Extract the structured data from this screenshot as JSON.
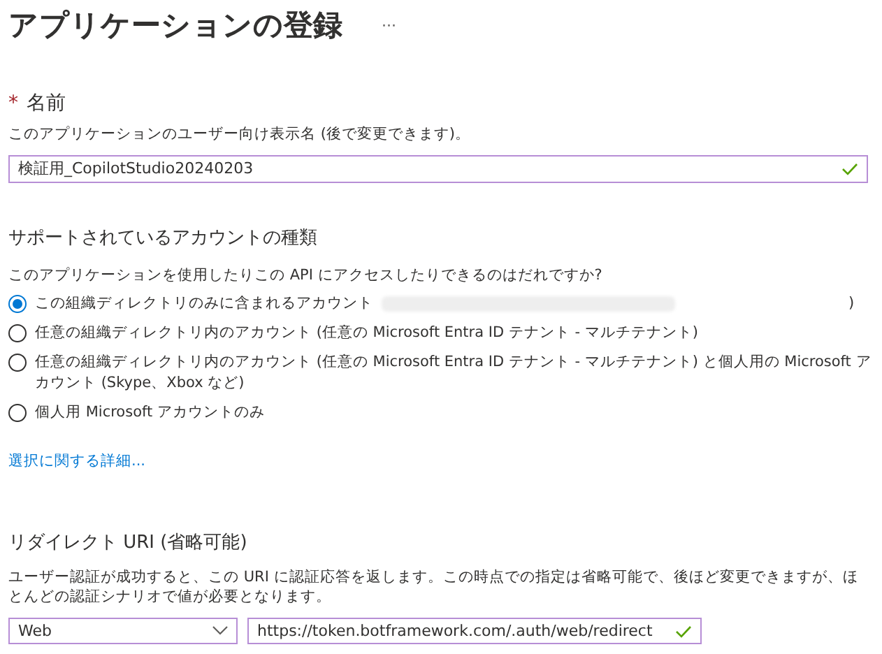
{
  "title": "アプリケーションの登録",
  "more": "···",
  "name_field": {
    "required_mark": "*",
    "label": "名前",
    "description": "このアプリケーションのユーザー向け表示名 (後で変更できます)。",
    "value": "検証用_CopilotStudio20240203",
    "valid": true
  },
  "account_types": {
    "heading": "サポートされているアカウントの種類",
    "question": "このアプリケーションを使用したりこの API にアクセスしたりできるのはだれですか?",
    "options": [
      {
        "label": "この組織ディレクトリのみに含まれるアカウント",
        "redacted": true,
        "suffix": ")",
        "selected": true
      },
      {
        "label": "任意の組織ディレクトリ内のアカウント (任意の Microsoft Entra ID テナント - マルチテナント)",
        "redacted": false,
        "selected": false
      },
      {
        "label": "任意の組織ディレクトリ内のアカウント (任意の Microsoft Entra ID テナント - マルチテナント) と個人用の Microsoft アカウント (Skype、Xbox など)",
        "redacted": false,
        "selected": false
      },
      {
        "label": "個人用 Microsoft アカウントのみ",
        "redacted": false,
        "selected": false
      }
    ],
    "link": "選択に関する詳細..."
  },
  "redirect": {
    "heading": "リダイレクト URI (省略可能)",
    "description": "ユーザー認証が成功すると、この URI に認証応答を返します。この時点での指定は省略可能で、後ほど変更できますが、ほとんどの認証シナリオで値が必要となります。",
    "platform": "Web",
    "uri": "https://token.botframework.com/.auth/web/redirect",
    "valid": true
  }
}
